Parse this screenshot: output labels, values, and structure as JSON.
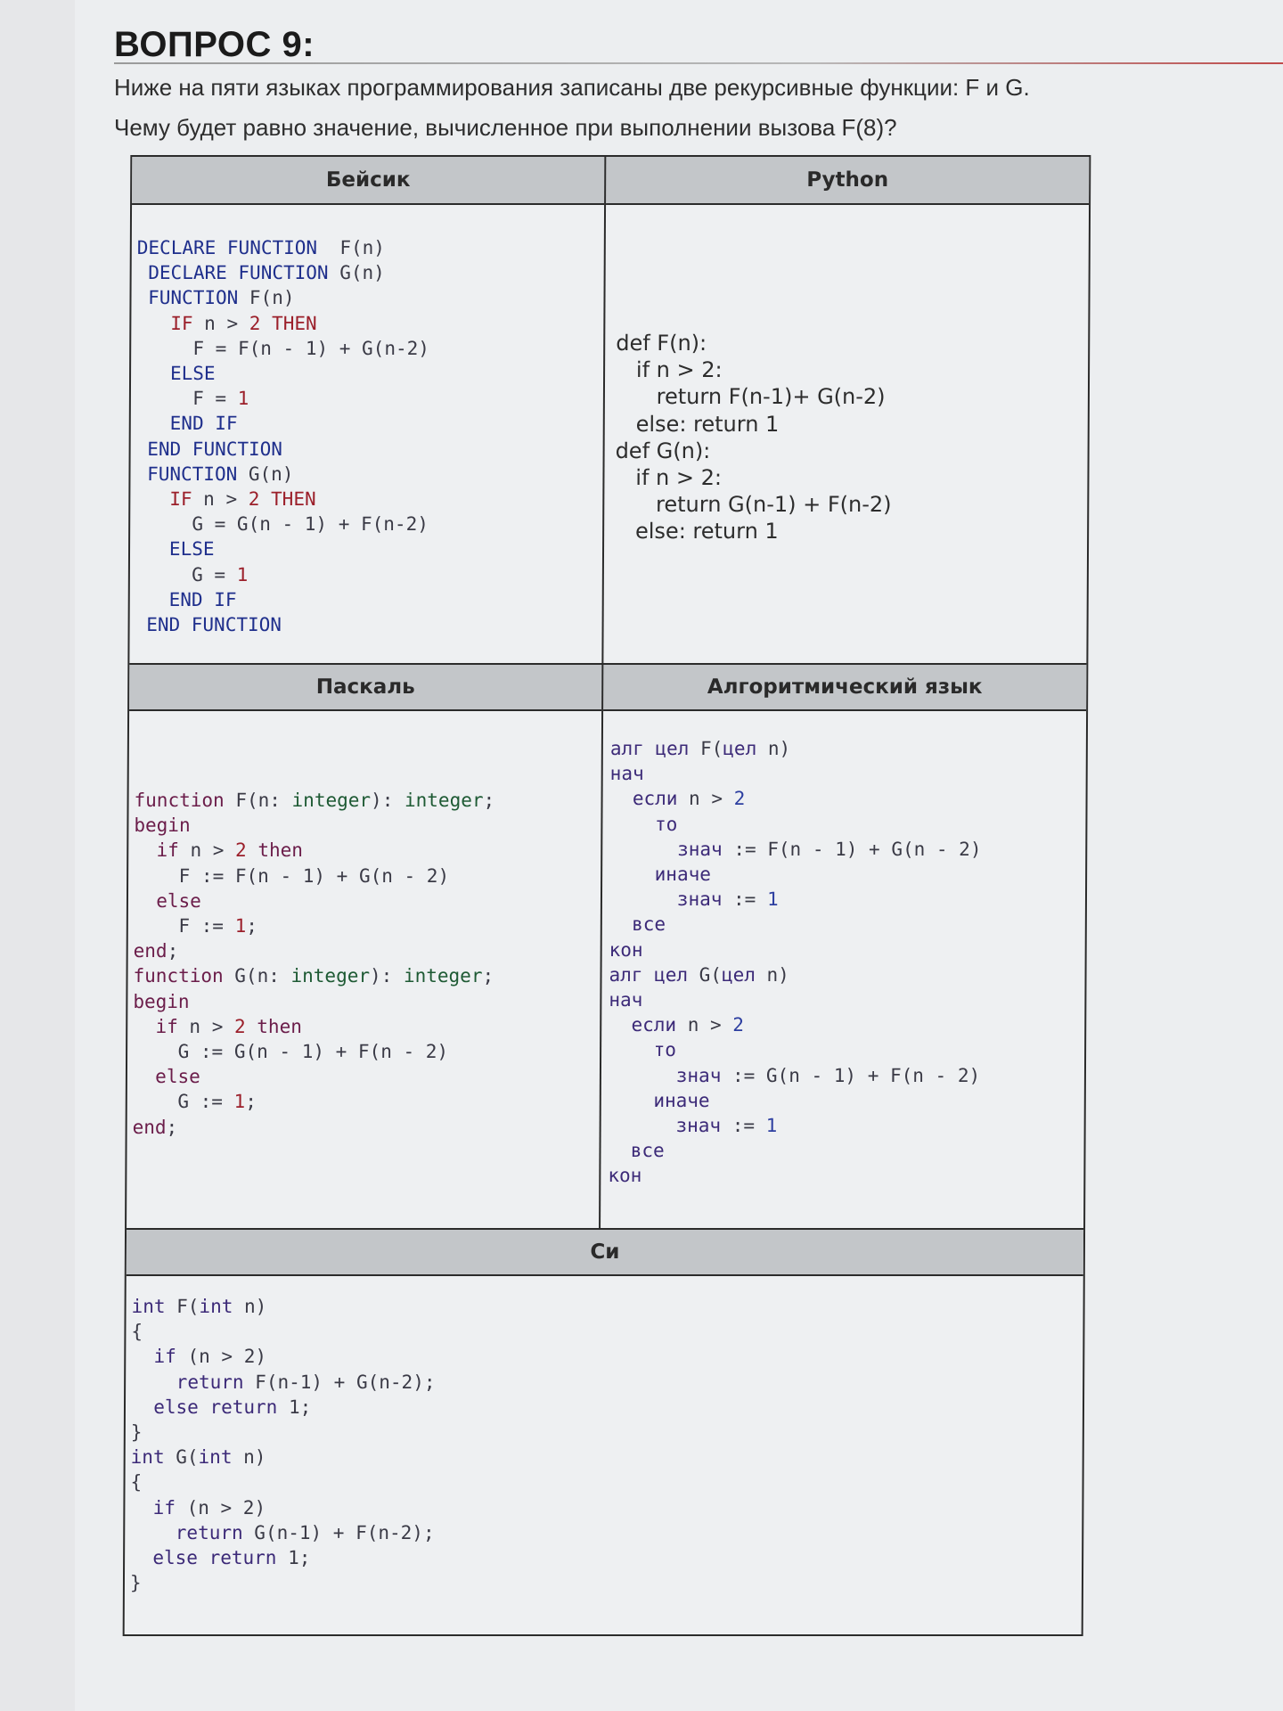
{
  "question": {
    "number_label": "ВОПРОС 9:",
    "line1": "Ниже на пяти языках программирования записаны две рекурсивные функции: F и G.",
    "line2": "Чему будет равно значение, вычисленное при выполнении вызова F(8)?"
  },
  "table": {
    "headers": {
      "basic": "Бейсик",
      "python": "Python",
      "pascal": "Паскаль",
      "algo": "Алгоритмический язык",
      "c": "Си"
    }
  },
  "colors": {
    "keyword_blue": "#1f2f8c",
    "keyword_red": "#9b1f2a",
    "keyword_green": "#1e5a34",
    "header_bg": "#c3c6c9"
  },
  "code": {
    "basic": [
      [
        [
          "kw-b",
          "DECLARE FUNCTION"
        ],
        [
          "",
          "  F(n)"
        ]
      ],
      [
        [
          "kw-b",
          " DECLARE FUNCTION"
        ],
        [
          "",
          " G(n)"
        ]
      ],
      [
        [
          "kw-b",
          " FUNCTION"
        ],
        [
          "",
          " F(n)"
        ]
      ],
      [
        [
          "kw-r",
          "   IF"
        ],
        [
          "",
          " n > "
        ],
        [
          "num",
          "2"
        ],
        [
          "kw-r",
          " THEN"
        ]
      ],
      [
        [
          "",
          "     F = F(n - 1) + G(n-2)"
        ]
      ],
      [
        [
          "kw-b",
          "   ELSE"
        ]
      ],
      [
        [
          "",
          "     F = "
        ],
        [
          "num",
          "1"
        ]
      ],
      [
        [
          "kw-b",
          "   END IF"
        ]
      ],
      [
        [
          "kw-b",
          " END FUNCTION"
        ]
      ],
      [
        [
          "kw-b",
          " FUNCTION"
        ],
        [
          "",
          " G(n)"
        ]
      ],
      [
        [
          "kw-r",
          "   IF"
        ],
        [
          "",
          " n > "
        ],
        [
          "num",
          "2"
        ],
        [
          "kw-r",
          " THEN"
        ]
      ],
      [
        [
          "",
          "     G = G(n - 1) + F(n-2)"
        ]
      ],
      [
        [
          "kw-b",
          "   ELSE"
        ]
      ],
      [
        [
          "",
          "     G = "
        ],
        [
          "num",
          "1"
        ]
      ],
      [
        [
          "kw-b",
          "   END IF"
        ]
      ],
      [
        [
          "kw-b",
          " END FUNCTION"
        ]
      ]
    ],
    "python": [
      [
        [
          "",
          "def F(n):"
        ]
      ],
      [
        [
          "",
          "   if n > 2:"
        ]
      ],
      [
        [
          "",
          "      return F(n-1)+ G(n-2)"
        ]
      ],
      [
        [
          "",
          "   else: return 1"
        ]
      ],
      [
        [
          "",
          "def G(n):"
        ]
      ],
      [
        [
          "",
          "   if n > 2:"
        ]
      ],
      [
        [
          "",
          "      return G(n-1) + F(n-2)"
        ]
      ],
      [
        [
          "",
          "   else: return 1"
        ]
      ]
    ],
    "pascal": [
      [
        [
          "kw-m",
          "function"
        ],
        [
          "",
          " F(n: "
        ],
        [
          "kw-g",
          "integer"
        ],
        [
          "",
          "): "
        ],
        [
          "kw-g",
          "integer"
        ],
        [
          "",
          ";"
        ]
      ],
      [
        [
          "kw-m",
          "begin"
        ]
      ],
      [
        [
          "kw-m",
          "  if"
        ],
        [
          "",
          " n > "
        ],
        [
          "num",
          "2"
        ],
        [
          "kw-m",
          " then"
        ]
      ],
      [
        [
          "",
          "    F := F(n - 1) + G(n - 2)"
        ]
      ],
      [
        [
          "kw-m",
          "  else"
        ]
      ],
      [
        [
          "",
          "    F := "
        ],
        [
          "num",
          "1"
        ],
        [
          "",
          ";"
        ]
      ],
      [
        [
          "kw-m",
          "end"
        ],
        [
          "",
          ";"
        ]
      ],
      [
        [
          "kw-m",
          "function"
        ],
        [
          "",
          " G(n: "
        ],
        [
          "kw-g",
          "integer"
        ],
        [
          "",
          "): "
        ],
        [
          "kw-g",
          "integer"
        ],
        [
          "",
          ";"
        ]
      ],
      [
        [
          "kw-m",
          "begin"
        ]
      ],
      [
        [
          "kw-m",
          "  if"
        ],
        [
          "",
          " n > "
        ],
        [
          "num",
          "2"
        ],
        [
          "kw-m",
          " then"
        ]
      ],
      [
        [
          "",
          "    G := G(n - 1) + F(n - 2)"
        ]
      ],
      [
        [
          "kw-m",
          "  else"
        ]
      ],
      [
        [
          "",
          "    G := "
        ],
        [
          "num",
          "1"
        ],
        [
          "",
          ";"
        ]
      ],
      [
        [
          "kw-m",
          "end"
        ],
        [
          "",
          ";"
        ]
      ]
    ],
    "algo": [
      [
        [
          "kw-c",
          "алг цел"
        ],
        [
          "",
          " F("
        ],
        [
          "kw-c",
          "цел"
        ],
        [
          "",
          " n)"
        ]
      ],
      [
        [
          "kw-c",
          "нач"
        ]
      ],
      [
        [
          "kw-c",
          "  если"
        ],
        [
          "",
          " n > "
        ],
        [
          "num-b",
          "2"
        ]
      ],
      [
        [
          "kw-c",
          "    то"
        ]
      ],
      [
        [
          "kw-c",
          "      знач"
        ],
        [
          "",
          " := F(n - 1) + G(n - 2)"
        ]
      ],
      [
        [
          "kw-c",
          "    иначе"
        ]
      ],
      [
        [
          "kw-c",
          "      знач"
        ],
        [
          "",
          " := "
        ],
        [
          "num-b",
          "1"
        ]
      ],
      [
        [
          "kw-c",
          "  все"
        ]
      ],
      [
        [
          "kw-c",
          "кон"
        ]
      ],
      [
        [
          "kw-c",
          "алг цел"
        ],
        [
          "",
          " G("
        ],
        [
          "kw-c",
          "цел"
        ],
        [
          "",
          " n)"
        ]
      ],
      [
        [
          "kw-c",
          "нач"
        ]
      ],
      [
        [
          "kw-c",
          "  если"
        ],
        [
          "",
          " n > "
        ],
        [
          "num-b",
          "2"
        ]
      ],
      [
        [
          "kw-c",
          "    то"
        ]
      ],
      [
        [
          "kw-c",
          "      знач"
        ],
        [
          "",
          " := G(n - 1) + F(n - 2)"
        ]
      ],
      [
        [
          "kw-c",
          "    иначе"
        ]
      ],
      [
        [
          "kw-c",
          "      знач"
        ],
        [
          "",
          " := "
        ],
        [
          "num-b",
          "1"
        ]
      ],
      [
        [
          "kw-c",
          "  все"
        ]
      ],
      [
        [
          "kw-c",
          "кон"
        ]
      ]
    ],
    "c": [
      [
        [
          "kw-c",
          "int"
        ],
        [
          "",
          " F("
        ],
        [
          "kw-c",
          "int"
        ],
        [
          "",
          " n)"
        ]
      ],
      [
        [
          "",
          "{"
        ]
      ],
      [
        [
          "kw-c",
          "  if"
        ],
        [
          "",
          " (n > 2)"
        ]
      ],
      [
        [
          "kw-c",
          "    return"
        ],
        [
          "",
          " F(n-1) + G(n-2);"
        ]
      ],
      [
        [
          "kw-c",
          "  else return"
        ],
        [
          "",
          " 1;"
        ]
      ],
      [
        [
          "",
          "}"
        ]
      ],
      [
        [
          "kw-c",
          "int"
        ],
        [
          "",
          " G("
        ],
        [
          "kw-c",
          "int"
        ],
        [
          "",
          " n)"
        ]
      ],
      [
        [
          "",
          "{"
        ]
      ],
      [
        [
          "kw-c",
          "  if"
        ],
        [
          "",
          " (n > 2)"
        ]
      ],
      [
        [
          "kw-c",
          "    return"
        ],
        [
          "",
          " G(n-1) + F(n-2);"
        ]
      ],
      [
        [
          "kw-c",
          "  else return"
        ],
        [
          "",
          " 1;"
        ]
      ],
      [
        [
          "",
          "}"
        ]
      ]
    ]
  }
}
